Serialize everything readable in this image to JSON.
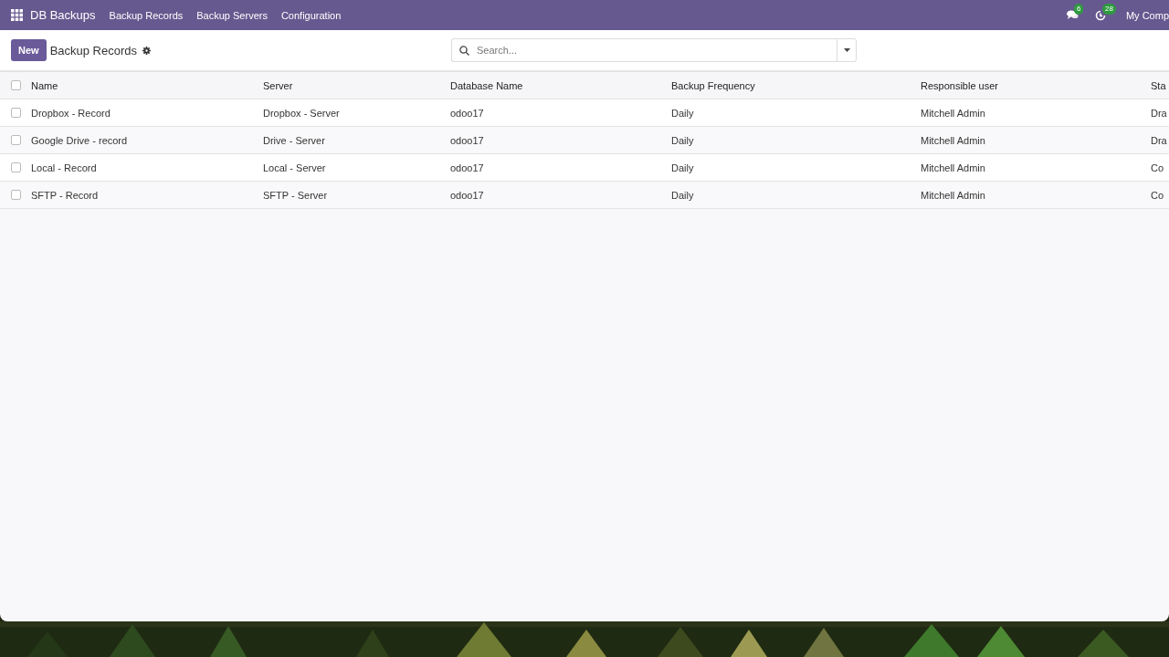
{
  "navbar": {
    "app_name": "DB Backups",
    "menu": [
      {
        "label": "Backup Records"
      },
      {
        "label": "Backup Servers"
      },
      {
        "label": "Configuration"
      }
    ],
    "messages_badge": "6",
    "activities_badge": "28",
    "company": "My Comp"
  },
  "control_panel": {
    "new_button": "New",
    "breadcrumb": "Backup Records",
    "search": {
      "placeholder": "Search..."
    }
  },
  "table": {
    "select_all": {
      "checked": false
    },
    "columns": [
      "Name",
      "Server",
      "Database Name",
      "Backup Frequency",
      "Responsible user",
      "Sta"
    ],
    "rows": [
      {
        "checked": false,
        "cells": [
          "Dropbox - Record",
          "Dropbox - Server",
          "odoo17",
          "Daily",
          "Mitchell Admin",
          "Dra"
        ]
      },
      {
        "checked": false,
        "cells": [
          "Google Drive - record",
          "Drive - Server",
          "odoo17",
          "Daily",
          "Mitchell Admin",
          "Dra"
        ]
      },
      {
        "checked": false,
        "cells": [
          "Local - Record",
          "Local - Server",
          "odoo17",
          "Daily",
          "Mitchell Admin",
          "Co"
        ]
      },
      {
        "checked": false,
        "cells": [
          "SFTP - Record",
          "SFTP - Server",
          "odoo17",
          "Daily",
          "Mitchell Admin",
          "Co"
        ]
      }
    ]
  }
}
